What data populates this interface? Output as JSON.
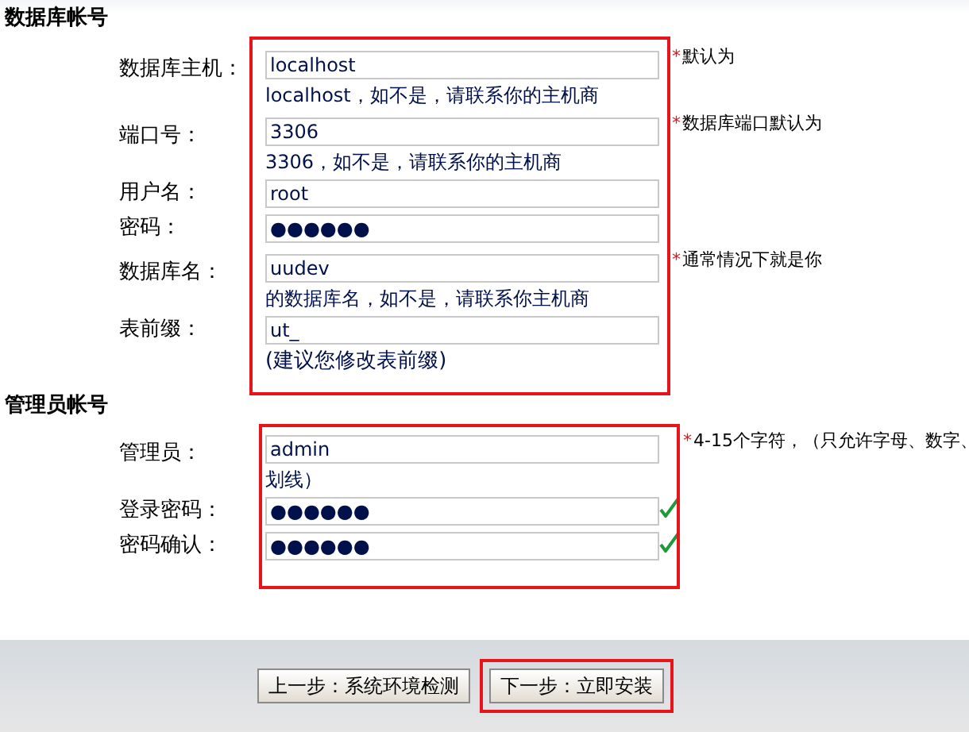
{
  "sections": [
    {
      "title": "数据库帐号",
      "fields": [
        {
          "label": "数据库主机：",
          "value": "localhost",
          "mark": "*",
          "hint": "默认为",
          "note": "localhost，如不是，请联系你的主机商"
        },
        {
          "label": "端口号：",
          "value": "3306",
          "mark": "*",
          "hint": "数据库端口默认为",
          "note": "3306，如不是，请联系你的主机商"
        },
        {
          "label": "用户名：",
          "value": "root"
        },
        {
          "label": "密码：",
          "value": "●●●●●●"
        },
        {
          "label": "数据库名：",
          "value": "uudev",
          "mark": "*",
          "hint": "通常情况下就是你",
          "note": "的数据库名，如不是，请联系你主机商"
        },
        {
          "label": "表前缀：",
          "value": "ut_",
          "suggestion": "(建议您修改表前缀)"
        }
      ]
    },
    {
      "title": "管理员帐号",
      "fields": [
        {
          "label": "管理员：",
          "value": "admin",
          "mark": "*",
          "hint": "4-15个字符，（只允许字母、数字、",
          "note": "划线）"
        },
        {
          "label": "登录密码：",
          "value": "●●●●●●",
          "valid": true
        },
        {
          "label": "密码确认：",
          "value": "●●●●●●",
          "valid": true
        }
      ]
    }
  ],
  "buttons": [
    {
      "label": "上一步：系统环境检测",
      "highlighted": false
    },
    {
      "label": "下一步：立即安装",
      "highlighted": true
    }
  ]
}
